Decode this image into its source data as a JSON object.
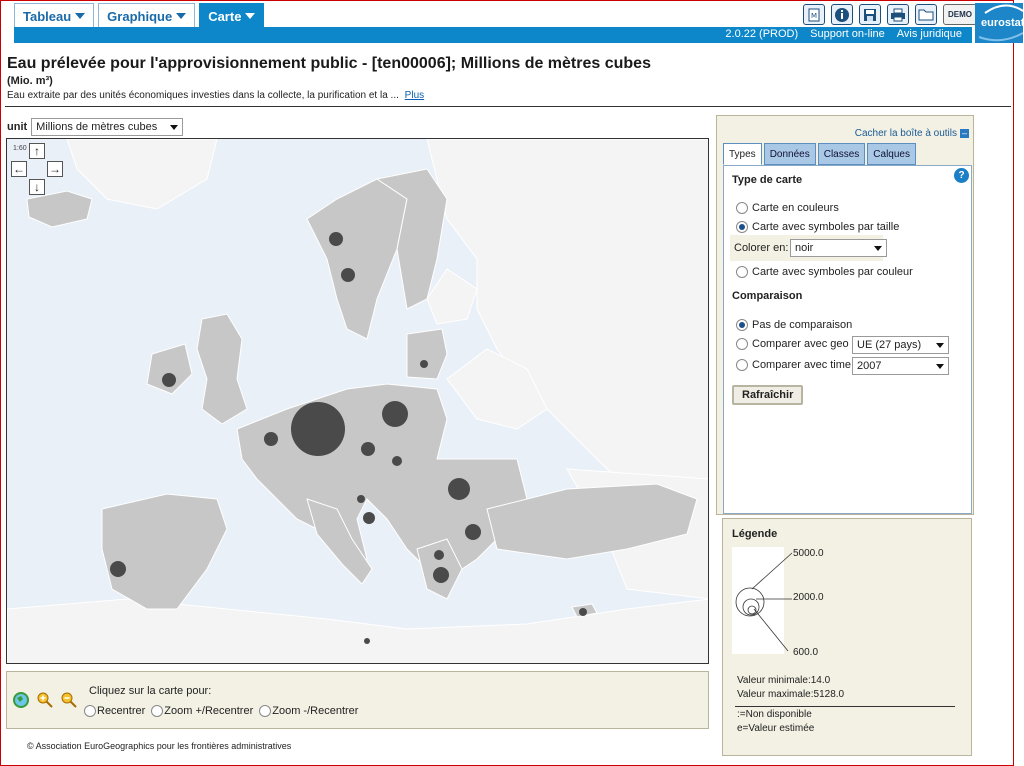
{
  "nav": {
    "tabs": [
      {
        "label": "Tableau",
        "active": false
      },
      {
        "label": "Graphique",
        "active": false
      },
      {
        "label": "Carte",
        "active": true
      }
    ],
    "toolbar_icons": [
      "metadata-icon",
      "info-icon",
      "save-icon",
      "print-icon",
      "folder-icon"
    ],
    "demo_label": "DEMO"
  },
  "bluebar": {
    "version": "2.0.22 (PROD)",
    "support": "Support on-line",
    "legal": "Avis juridique"
  },
  "brand": {
    "logo_text": "eurostat",
    "accent": "#0d87c9"
  },
  "header": {
    "title": "Eau prélevée pour l'approvisionnement public - [ten00006]; Millions de mètres cubes",
    "subtitle": "(Mio. m³)",
    "description": "Eau extraite par des unités économiques investies dans la collecte, la purification et la ...",
    "more_link": "Plus"
  },
  "unit_select": {
    "label": "unit",
    "value": "Millions de mètres cubes"
  },
  "map": {
    "scale_label": "1:60",
    "symbols": [
      {
        "country": "Norway",
        "size": "medium"
      },
      {
        "country": "Sweden",
        "size": "medium"
      },
      {
        "country": "Lithuania",
        "size": "small"
      },
      {
        "country": "Ireland",
        "size": "medium"
      },
      {
        "country": "Germany",
        "size": "large"
      },
      {
        "country": "Poland",
        "size": "large-medium"
      },
      {
        "country": "Belgium",
        "size": "medium"
      },
      {
        "country": "Czech Republic",
        "size": "medium"
      },
      {
        "country": "Slovakia",
        "size": "small"
      },
      {
        "country": "Romania",
        "size": "medium-large"
      },
      {
        "country": "Slovenia",
        "size": "small"
      },
      {
        "country": "Croatia",
        "size": "small"
      },
      {
        "country": "Bulgaria",
        "size": "medium"
      },
      {
        "country": "Portugal",
        "size": "medium"
      },
      {
        "country": "Macedonia",
        "size": "small"
      },
      {
        "country": "Greece",
        "size": "medium"
      },
      {
        "country": "Cyprus",
        "size": "small"
      },
      {
        "country": "Malta",
        "size": "small"
      }
    ],
    "colors": {
      "sea": "#e9f0f8",
      "land_data": "#c7c7c7",
      "land_other": "#f4f4f4",
      "border": "#ffffff",
      "symbol": "#4a4a4a"
    }
  },
  "map_footer": {
    "instruction": "Cliquez sur la carte pour:",
    "options": [
      {
        "label": "Recentrer",
        "checked": false
      },
      {
        "label": "Zoom +/Recentrer",
        "checked": false
      },
      {
        "label": "Zoom -/Recentrer",
        "checked": false
      }
    ]
  },
  "copyright": "© Association EuroGeographics pour les frontières administratives",
  "tools": {
    "hide_label": "Cacher la boîte à outils",
    "tabs": [
      {
        "label": "Types",
        "active": true
      },
      {
        "label": "Données",
        "active": false
      },
      {
        "label": "Classes",
        "active": false
      },
      {
        "label": "Calques",
        "active": false
      }
    ],
    "map_type_title": "Type de carte",
    "map_types": [
      {
        "label": "Carte en couleurs",
        "checked": false
      },
      {
        "label": "Carte avec symboles par taille",
        "checked": true
      },
      {
        "label": "Carte avec symboles par couleur",
        "checked": false
      }
    ],
    "color_in": {
      "label": "Colorer en:",
      "value": "noir"
    },
    "comparison_title": "Comparaison",
    "comparisons": [
      {
        "label": "Pas de comparaison",
        "checked": true
      },
      {
        "label": "Comparer avec geo",
        "checked": false,
        "value": "UE (27 pays)"
      },
      {
        "label": "Comparer avec time",
        "checked": false,
        "value": "2007"
      }
    ],
    "refresh_label": "Rafraîchir",
    "help_label": "?"
  },
  "legend": {
    "title": "Légende",
    "values": [
      "5000.0",
      "2000.0",
      "600.0"
    ],
    "min_label": "Valeur minimale:14.0",
    "max_label": "Valeur maximale:5128.0",
    "na_label": ":=Non disponible",
    "est_label": "e=Valeur estimée"
  }
}
